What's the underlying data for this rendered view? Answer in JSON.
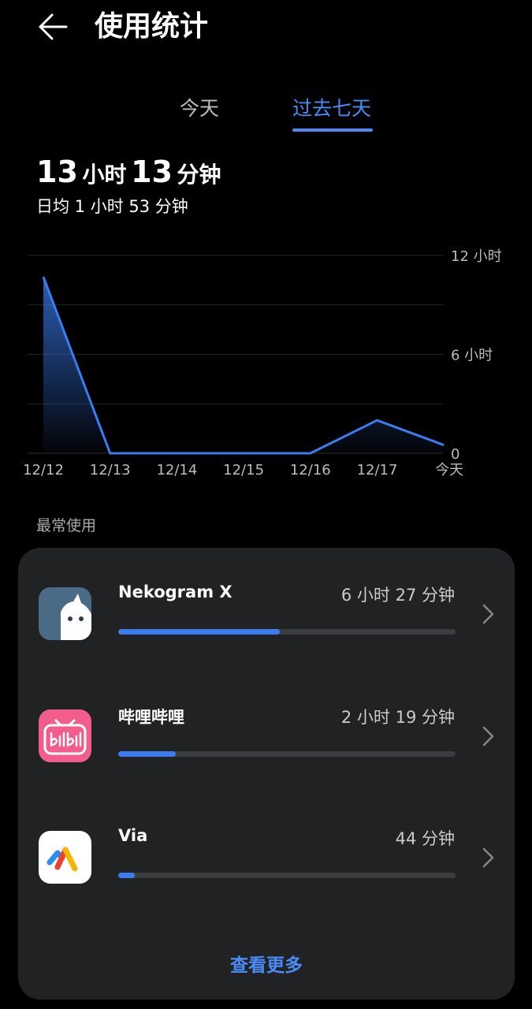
{
  "header": {
    "title": "使用统计"
  },
  "tabs": [
    {
      "label": "今天"
    },
    {
      "label": "过去七天"
    }
  ],
  "summary": {
    "hours": "13",
    "hours_unit": "小时",
    "minutes": "13",
    "minutes_unit": "分钟",
    "daily_average": "日均 1 小时 53 分钟"
  },
  "chart_data": {
    "type": "area",
    "categories": [
      "12/12",
      "12/13",
      "12/14",
      "12/15",
      "12/16",
      "12/17",
      "今天"
    ],
    "values": [
      10.7,
      0,
      0,
      0,
      0,
      2.0,
      0.5
    ],
    "y_tick_labels": [
      {
        "value": 12,
        "label": "12 小时"
      },
      {
        "value": 6,
        "label": "6 小时"
      },
      {
        "value": 0,
        "label": "0"
      }
    ],
    "ylim": [
      0,
      12
    ],
    "gridlines": [
      0,
      3,
      6,
      9,
      12
    ],
    "line_color": "#3b7cf1"
  },
  "most_used": {
    "label": "最常使用",
    "apps": [
      {
        "name": "Nekogram X",
        "time": "6 小时 27 分钟",
        "fraction": 0.48
      },
      {
        "name": "哔哩哔哩",
        "time": "2 小时 19 分钟",
        "fraction": 0.17
      },
      {
        "name": "Via",
        "time": "44 分钟",
        "fraction": 0.05
      }
    ],
    "see_more": "查看更多"
  },
  "colors": {
    "accent": "#4a8cf7",
    "background": "#000000",
    "card": "#212224"
  }
}
